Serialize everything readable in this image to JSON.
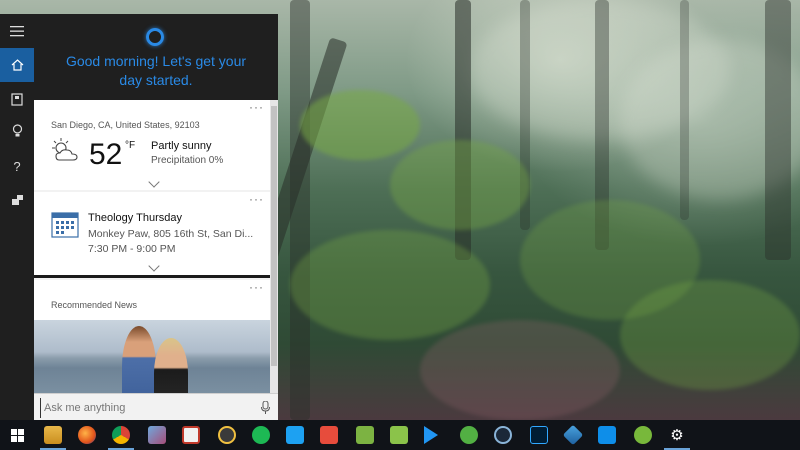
{
  "cortana": {
    "greeting_line1": "Good morning! Let's get your",
    "greeting_line2": "day started.",
    "rail": [
      "hamburger-menu-icon",
      "home-icon",
      "notebook-icon",
      "lightbulb-icon",
      "help-icon",
      "feedback-icon"
    ],
    "weather": {
      "location": "San Diego, CA, United States, 92103",
      "temperature": "52",
      "unit": "°F",
      "condition": "Partly sunny",
      "precipitation": "Precipitation 0%",
      "more": "···"
    },
    "event": {
      "title": "Theology Thursday",
      "location": "Monkey Paw, 805 16th St, San Di...",
      "time": "7:30 PM - 9:00 PM",
      "more": "···"
    },
    "news": {
      "label": "Recommended News",
      "more": "···"
    },
    "search": {
      "placeholder": "Ask me anything"
    }
  },
  "taskbar": {
    "icons": [
      "windows-start-icon",
      "file-explorer-icon",
      "firefox-icon",
      "chrome-icon",
      "paint-icon",
      "app-icon",
      "app-icon",
      "spotify-icon",
      "twitter-icon",
      "app-icon",
      "app-icon",
      "app-icon",
      "media-player-icon",
      "xbox-icon",
      "steam-icon",
      "photoshop-icon",
      "virtualbox-icon",
      "teamviewer-icon",
      "utorrent-icon",
      "settings-gear-icon"
    ]
  },
  "colors": {
    "accent": "#2a8ae6",
    "rail_active": "#1a5fa0",
    "panel_dark": "#1f1f1f",
    "taskbar": "#101318"
  }
}
